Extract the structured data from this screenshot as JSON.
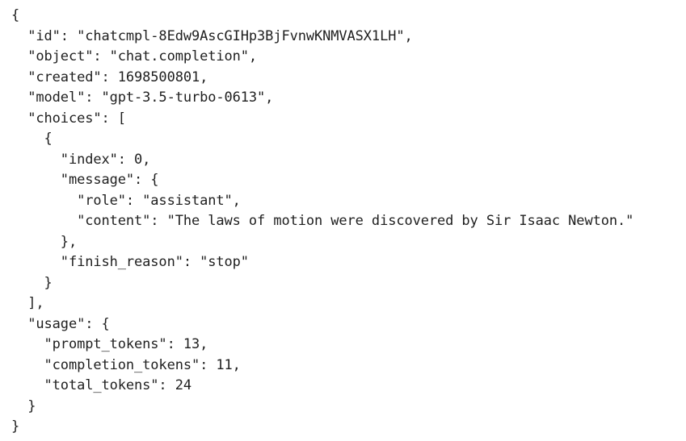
{
  "document": {
    "lines": [
      "{",
      "  \"id\": \"chatcmpl-8Edw9AscGIHp3BjFvnwKNMVASX1LH\",",
      "  \"object\": \"chat.completion\",",
      "  \"created\": 1698500801,",
      "  \"model\": \"gpt-3.5-turbo-0613\",",
      "  \"choices\": [",
      "    {",
      "      \"index\": 0,",
      "      \"message\": {",
      "        \"role\": \"assistant\",",
      "        \"content\": \"The laws of motion were discovered by Sir Isaac Newton.\"",
      "      },",
      "      \"finish_reason\": \"stop\"",
      "    }",
      "  ],",
      "  \"usage\": {",
      "    \"prompt_tokens\": 13,",
      "    \"completion_tokens\": 11,",
      "    \"total_tokens\": 24",
      "  }",
      "}"
    ]
  }
}
